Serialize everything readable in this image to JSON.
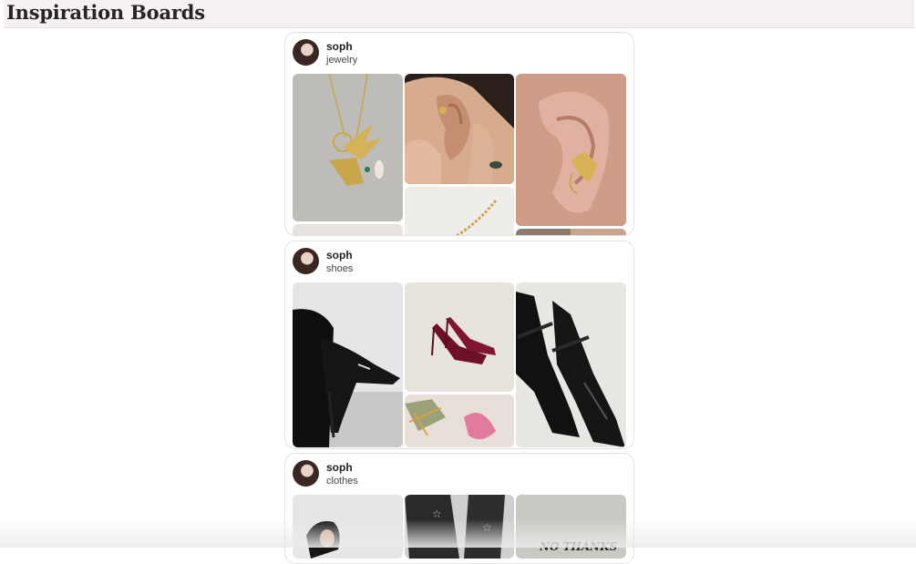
{
  "page": {
    "title": "Inspiration Boards"
  },
  "boards": [
    {
      "user": "soph",
      "name": "jewelry"
    },
    {
      "user": "soph",
      "name": "shoes"
    },
    {
      "user": "soph",
      "name": "clothes"
    }
  ],
  "image_text": {
    "no_thanks": "NO THANKS"
  }
}
